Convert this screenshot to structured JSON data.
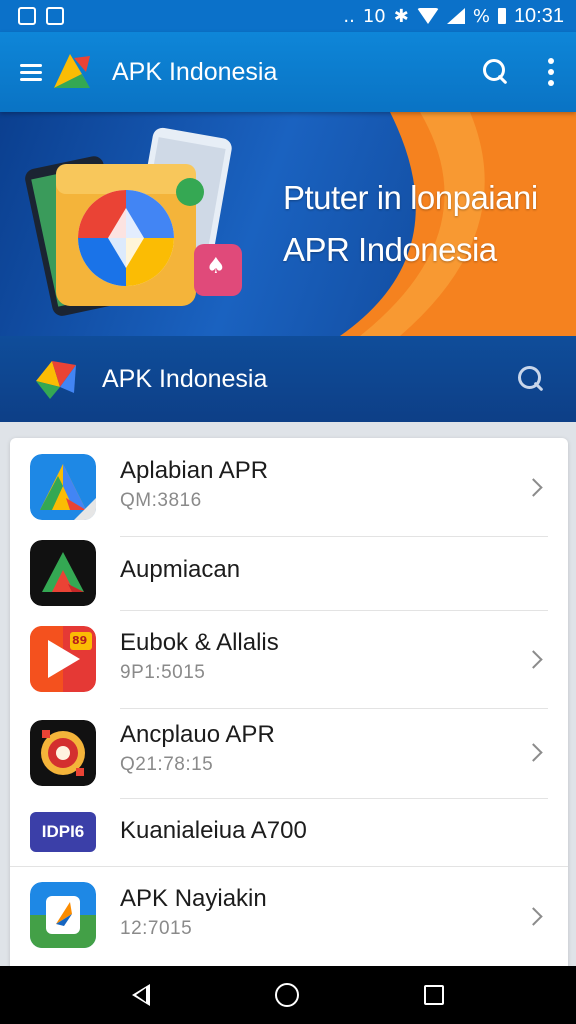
{
  "status_bar": {
    "left_icons": [
      "gallery-icon",
      "photo-icon"
    ],
    "network_label": "..",
    "sim_label": "10",
    "battery_label": "%",
    "time": "10:31"
  },
  "app_bar": {
    "title": "APK Indonesia",
    "icons": [
      "menu-icon",
      "search-icon",
      "more-vert-icon"
    ]
  },
  "banner": {
    "line1": "Ptuter in lonpaiani",
    "line2": "APR Indonesia",
    "icon_glyph": "♠"
  },
  "sub_header": {
    "title": "APK Indonesia"
  },
  "apps": [
    {
      "title": "Aplabian APR",
      "subtitle": "QM:3816",
      "icon_text": ""
    },
    {
      "title": "Aupmiacan",
      "subtitle": "",
      "icon_text": ""
    },
    {
      "title": "Eubok & Allalis",
      "subtitle": "9P1:5015",
      "icon_text": "89"
    },
    {
      "title": "Ancplauo APR",
      "subtitle": "Q21:78:15",
      "icon_text": ""
    },
    {
      "title": "Kuanialeiua A700",
      "subtitle": "",
      "icon_text": "IDPI6"
    },
    {
      "title": "APK Nayiakin",
      "subtitle": "12:7015",
      "icon_text": ""
    }
  ],
  "colors": {
    "primary": "#0b71c9",
    "banner_dark": "#0b3f8f",
    "accent_orange": "#f5821f"
  }
}
